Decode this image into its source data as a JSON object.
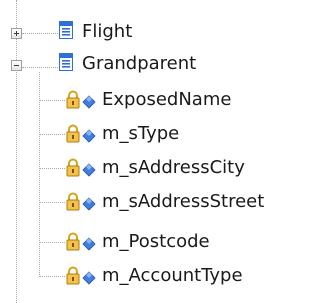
{
  "tree": {
    "nodes": [
      {
        "label": "Flight",
        "expanded": false,
        "icon": "class-icon"
      },
      {
        "label": "Grandparent",
        "expanded": true,
        "icon": "class-icon",
        "children": [
          {
            "label": "ExposedName",
            "icon": "private-property-icon"
          },
          {
            "label": "m_sType",
            "icon": "private-property-icon"
          },
          {
            "label": "m_sAddressCity",
            "icon": "private-property-icon"
          },
          {
            "label": "m_sAddressStreet",
            "icon": "private-property-icon"
          },
          {
            "label": "m_Postcode",
            "icon": "private-property-icon"
          },
          {
            "label": "m_AccountType",
            "icon": "private-property-icon"
          }
        ]
      }
    ]
  },
  "colors": {
    "class_icon_blue": "#2f6fd6",
    "lock_gold": "#d9a21b",
    "diamond_blue": "#3f7fe0",
    "tree_lines": "#a8a8a8"
  }
}
